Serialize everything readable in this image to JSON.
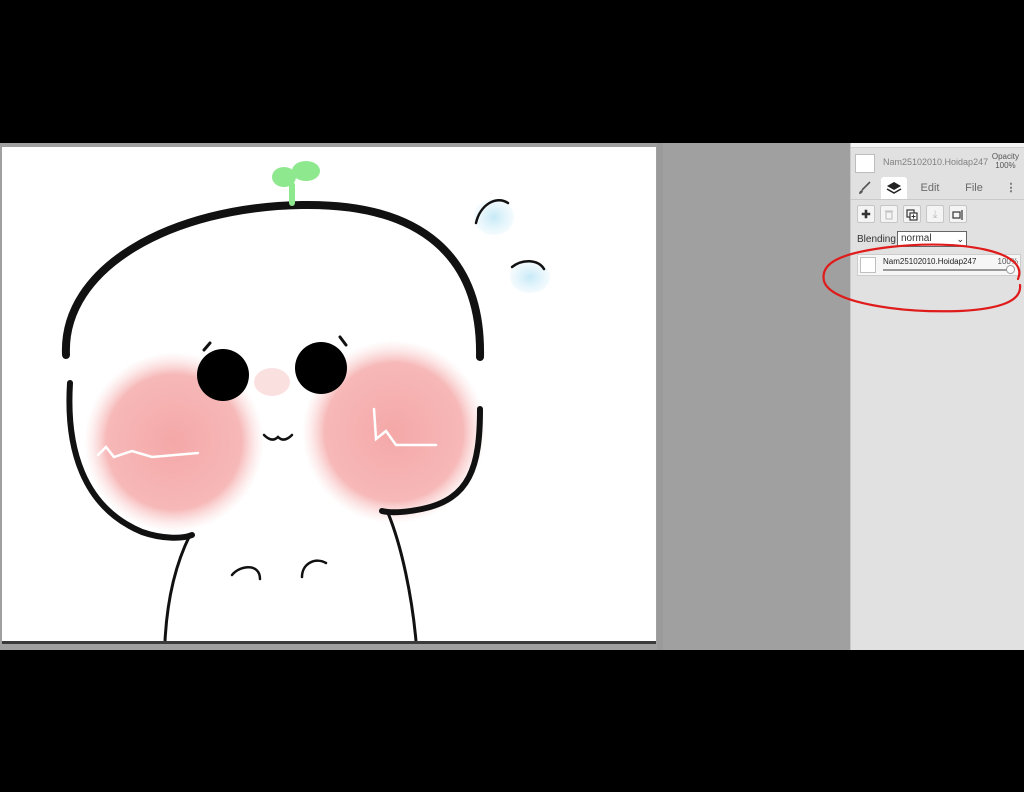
{
  "document": {
    "name": "Nam25102010.Hoidap247",
    "opacity_label": "Opacity",
    "opacity_value": "100%"
  },
  "tabs": [
    {
      "icon": "brush-icon"
    },
    {
      "icon": "layers-icon",
      "active": true
    },
    {
      "label": "Edit"
    },
    {
      "label": "File"
    },
    {
      "icon": "more-vertical-icon"
    }
  ],
  "toolbar": [
    {
      "icon": "add-layer-icon",
      "enabled": true
    },
    {
      "icon": "delete-layer-icon",
      "enabled": false
    },
    {
      "icon": "duplicate-layer-icon",
      "enabled": true
    },
    {
      "icon": "merge-down-icon",
      "enabled": false
    },
    {
      "icon": "layer-properties-icon",
      "enabled": true
    }
  ],
  "blending": {
    "label": "Blending",
    "value": "normal"
  },
  "layers": [
    {
      "name": "Nam25102010.Hoidap247",
      "opacity": "100%",
      "opacity_fraction": 1.0
    }
  ],
  "colors": {
    "annotation": "#e01b1b",
    "blush": "#f4a7a7",
    "sprout": "#8ee88e",
    "tear": "#bfe6f5",
    "panel_bg": "#e1e1e1",
    "workspace_bg": "#a0a0a0"
  }
}
